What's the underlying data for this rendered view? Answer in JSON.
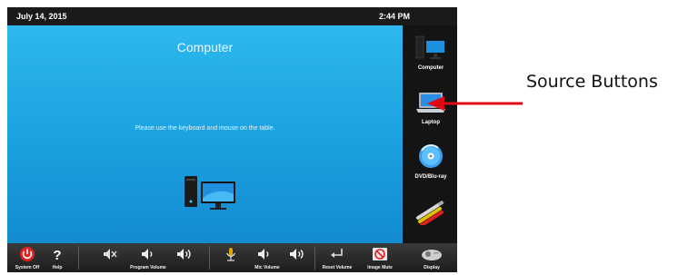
{
  "topbar": {
    "date": "July 14, 2015",
    "time": "2:44 PM"
  },
  "main": {
    "title": "Computer",
    "message": "Please use the keyboard and mouse on the table."
  },
  "sources": [
    {
      "label": "Computer",
      "icon": "computer-icon"
    },
    {
      "label": "Laptop",
      "icon": "laptop-icon"
    },
    {
      "label": "DVD/Blu-ray",
      "icon": "disc-icon"
    },
    {
      "label": "",
      "icon": "av-cables-icon"
    }
  ],
  "bottom": {
    "system_off": "System Off",
    "help": "Help",
    "program_volume": "Program Volume",
    "mic_volume": "Mic Volume",
    "reset_volume": "Reset Volume",
    "image_mute": "Image Mute",
    "display": "Display"
  },
  "callout": {
    "label": "Source Buttons",
    "color": "#e30613"
  },
  "colors": {
    "power": "#e32121",
    "accent": "#1aa0df"
  }
}
